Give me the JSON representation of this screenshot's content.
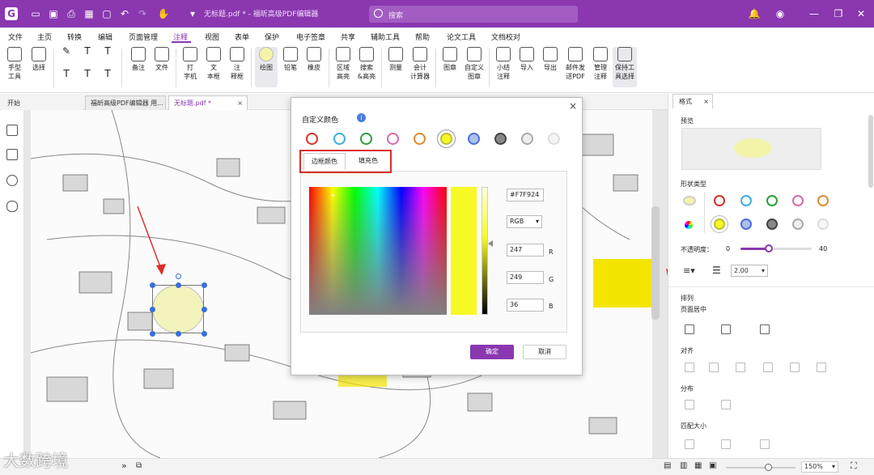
{
  "titlebar": {
    "doc_title": "无标题.pdf * - 福昕高级PDF编辑器",
    "search_placeholder": "搜索",
    "accent": "#8a37b0"
  },
  "menu": [
    "文件",
    "主页",
    "转换",
    "编辑",
    "页面管理",
    "注释",
    "视图",
    "表单",
    "保护",
    "电子签章",
    "共享",
    "辅助工具",
    "帮助",
    "论文工具",
    "文档校对"
  ],
  "active_menu": "注释",
  "ribbon": {
    "hand": "手型\n工具",
    "select": "选择",
    "note": "备注",
    "file": "文件",
    "typewriter": "打\n字机",
    "textbox": "文\n本框",
    "callout": "注\n释框",
    "draw": "绘图",
    "pencil": "铅笔",
    "eraser": "橡皮",
    "area_highlight": "区域\n高亮",
    "search_highlight": "搜索\n&高亮",
    "measure": "测量",
    "calc": "会计\n计算器",
    "stamp": "图章",
    "custom_stamp": "自定义\n图章",
    "summary": "小结\n注释",
    "import": "导入",
    "export": "导出",
    "email_pdf": "邮件发\n送PDF",
    "manage": "管理\n注释",
    "keep_tool": "保持工\n具选择"
  },
  "tabs": [
    {
      "label": "开始"
    },
    {
      "label": "福昕高级PDF编辑器 用..."
    },
    {
      "label": "无标题.pdf *"
    }
  ],
  "dialog": {
    "title": "自定义颜色",
    "info": "i",
    "close": "×",
    "swatches": [
      "#d9302b",
      "#3ab0d9",
      "#2f9e3a",
      "#d96aa6",
      "#e08a2a",
      "#f7f924",
      "#4b6fd8",
      "#444444",
      "#aaaaaa",
      "#dddddd"
    ],
    "tab_border": "边框颜色",
    "tab_fill": "填充色",
    "hex": "#F7F924",
    "mode": "RGB",
    "r": "247",
    "g": "249",
    "b": "36",
    "label_r": "R",
    "label_g": "G",
    "label_b": "B",
    "ok": "确定",
    "cancel": "取消"
  },
  "right_panel": {
    "tab": "格式",
    "tab_close": "×",
    "preview": "预览",
    "shape_type": "形状类型",
    "opacity_label": "不透明度：",
    "opacity_min": "0",
    "opacity_value": "40",
    "opacity_fraction": 0.4,
    "line_width": "2.00",
    "arrange": "排列",
    "page_center": "页面居中",
    "align": "对齐",
    "distribute": "分布",
    "match_size": "匹配大小",
    "row1": [
      "#d9302b",
      "#3ab0d9",
      "#2f9e3a",
      "#d96aa6",
      "#e08a2a"
    ],
    "row2": [
      "#f7f924",
      "#4b6fd8",
      "#444444",
      "#aaaaaa",
      "#dddddd"
    ]
  },
  "status": {
    "zoom": "150%",
    "zoom_fraction": 0.6
  },
  "watermark": "大数跨境"
}
